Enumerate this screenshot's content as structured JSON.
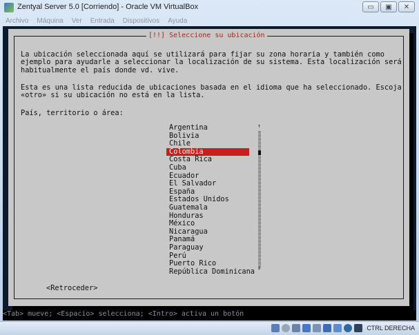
{
  "window": {
    "title": "Zentyal Server 5.0 [Corriendo] - Oracle VM VirtualBox",
    "buttons": {
      "minimize": "▭",
      "maximize": "▣",
      "close": "✕"
    }
  },
  "menubar": [
    "Archivo",
    "Máquina",
    "Ver",
    "Entrada",
    "Dispositivos",
    "Ayuda"
  ],
  "dialog": {
    "title": "[!!] Seleccione su ubicación",
    "para1": "La ubicación seleccionada aquí se utilizará para fijar su zona horaria y también como\nejemplo para ayudarle a seleccionar la localización de su sistema. Esta localización será\nhabitualmente el país donde vd. vive.",
    "para2": "Esta es una lista reducida de ubicaciones basada en el idioma que ha seleccionado. Escoja\n«otro» si su ubicación no está en la lista.",
    "prompt": "País, territorio o área:",
    "countries": [
      "Argentina",
      "Bolivia",
      "Chile",
      "Colombia",
      "Costa Rica",
      "Cuba",
      "Ecuador",
      "El Salvador",
      "España",
      "Estados Unidos",
      "Guatemala",
      "Honduras",
      "México",
      "Nicaragua",
      "Panamá",
      "Paraguay",
      "Perú",
      "Puerto Rico",
      "República Dominicana"
    ],
    "selected": "Colombia",
    "scroll_up": "↑",
    "scroll_down": "↓",
    "back_button": "<Retroceder>"
  },
  "hint": "<Tab> mueve; <Espacio> selecciona; <Intro> activa un botón",
  "status": {
    "host_key": "CTRL DERECHA",
    "tray_icons": [
      "hdd-icon",
      "cd-icon",
      "usb-icon",
      "shared-folder-icon",
      "display-icon",
      "network-icon",
      "video-capture-icon",
      "mouse-integration-icon",
      "cpu-icon"
    ]
  },
  "colors": {
    "selection": "#c81e1e",
    "dialog_bg": "#c8c8c8",
    "title_red": "#b22222"
  }
}
